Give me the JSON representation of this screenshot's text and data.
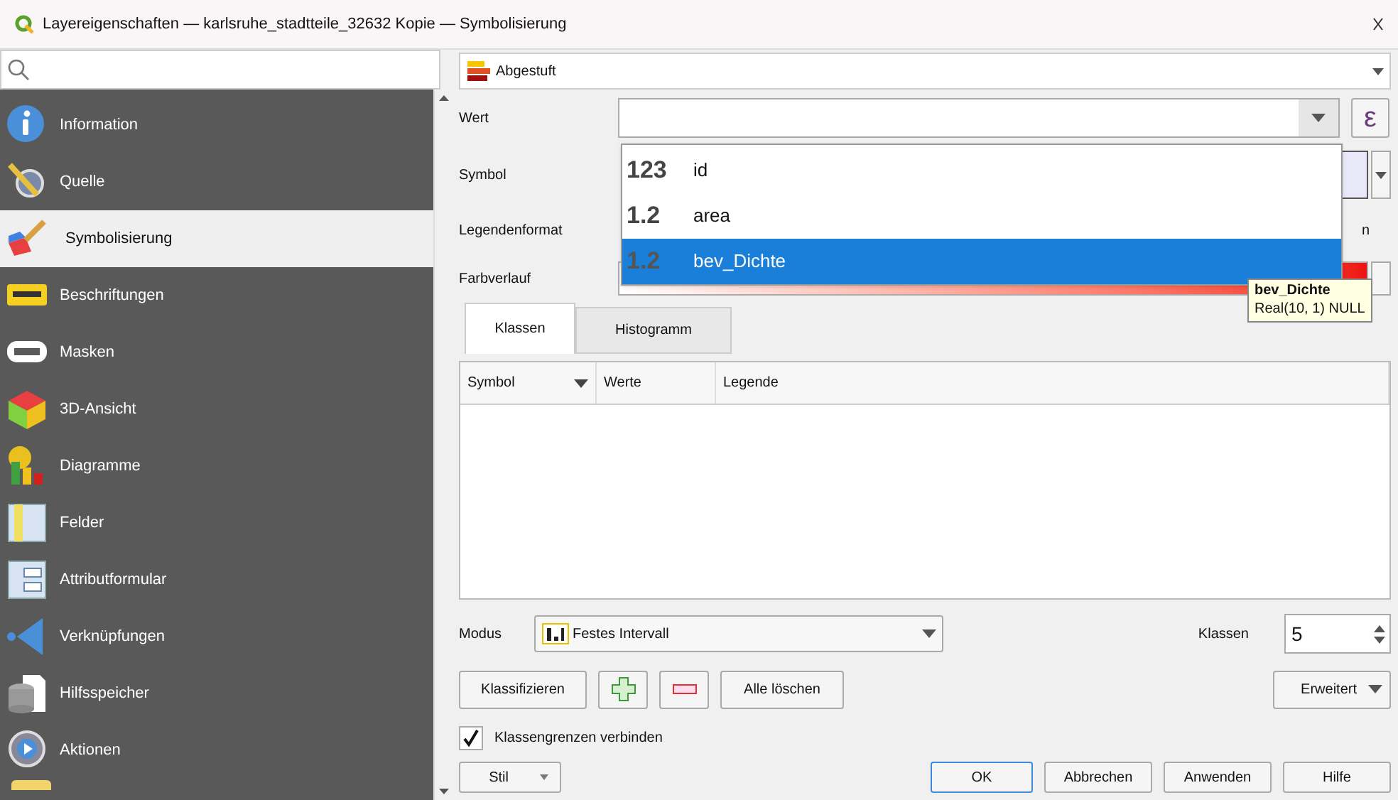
{
  "window": {
    "title": "Layereigenschaften — karlsruhe_stadtteile_32632 Kopie — Symbolisierung"
  },
  "sidebar": {
    "items": [
      {
        "label": "Information",
        "kind": "info",
        "selected": false
      },
      {
        "label": "Quelle",
        "kind": "source",
        "selected": false
      },
      {
        "label": "Symbolisierung",
        "kind": "brush",
        "selected": true
      },
      {
        "label": "Beschriftungen",
        "kind": "labels",
        "selected": false
      },
      {
        "label": "Masken",
        "kind": "masks",
        "selected": false
      },
      {
        "label": "3D-Ansicht",
        "kind": "cube",
        "selected": false
      },
      {
        "label": "Diagramme",
        "kind": "chart",
        "selected": false
      },
      {
        "label": "Felder",
        "kind": "fields",
        "selected": false
      },
      {
        "label": "Attributformular",
        "kind": "form",
        "selected": false
      },
      {
        "label": "Verknüpfungen",
        "kind": "join",
        "selected": false
      },
      {
        "label": "Hilfsspeicher",
        "kind": "storage",
        "selected": false
      },
      {
        "label": "Aktionen",
        "kind": "actions",
        "selected": false
      }
    ]
  },
  "renderer": {
    "value": "Abgestuft"
  },
  "form": {
    "value_label": "Wert",
    "symbol_label": "Symbol",
    "legend_format_label": "Legendenformat",
    "legend_format_fragment": "n",
    "color_ramp_label": "Farbverlauf",
    "expression_button": "ε"
  },
  "field_dropdown": {
    "options": [
      {
        "type": "123",
        "name": "id",
        "selected": false
      },
      {
        "type": "1.2",
        "name": "area",
        "selected": false
      },
      {
        "type": "1.2",
        "name": "bev_Dichte",
        "selected": true
      }
    ]
  },
  "tooltip": {
    "title": "bev_Dichte",
    "detail": "Real(10, 1) NULL"
  },
  "tabs": [
    {
      "label": "Klassen",
      "selected": true
    },
    {
      "label": "Histogramm",
      "selected": false
    }
  ],
  "table": {
    "columns": [
      "Symbol",
      "Werte",
      "Legende"
    ]
  },
  "mode": {
    "label": "Modus",
    "value": "Festes Intervall"
  },
  "classes": {
    "label": "Klassen",
    "value": "5"
  },
  "actions": {
    "classify": "Klassifizieren",
    "delete_all": "Alle löschen",
    "advanced": "Erweitert"
  },
  "link_boundaries": {
    "label": "Klassengrenzen verbinden",
    "checked": true
  },
  "footer": {
    "style": "Stil",
    "buttons": [
      "OK",
      "Abbrechen",
      "Anwenden",
      "Hilfe"
    ]
  }
}
